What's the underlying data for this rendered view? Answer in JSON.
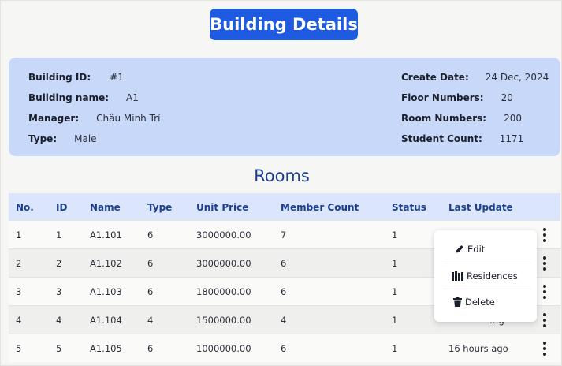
{
  "page": {
    "title": "Building Details"
  },
  "building": {
    "id_label": "Building ID:",
    "id_value": "#1",
    "name_label": "Building name:",
    "name_value": "A1",
    "manager_label": "Manager:",
    "manager_value": "Châu Minh Trí",
    "type_label": "Type:",
    "type_value": "Male",
    "create_label": "Create Date:",
    "create_value": "24 Dec, 2024",
    "floors_label": "Floor Numbers:",
    "floors_value": "20",
    "rooms_label": "Room Numbers:",
    "rooms_value": "200",
    "students_label": "Student Count:",
    "students_value": "1171"
  },
  "rooms": {
    "title": "Rooms",
    "headers": [
      "No.",
      "ID",
      "Name",
      "Type",
      "Unit Price",
      "Member Count",
      "Status",
      "Last Update"
    ],
    "rows": [
      [
        "1",
        "1",
        "A1.101",
        "6",
        "3000000.00",
        "7",
        "1",
        ""
      ],
      [
        "2",
        "2",
        "A1.102",
        "6",
        "3000000.00",
        "6",
        "1",
        ""
      ],
      [
        "3",
        "3",
        "A1.103",
        "6",
        "1800000.00",
        "6",
        "1",
        ""
      ],
      [
        "4",
        "4",
        "A1.104",
        "4",
        "1500000.00",
        "4",
        "1",
        "…g"
      ],
      [
        "5",
        "5",
        "A1.105",
        "6",
        "1000000.00",
        "6",
        "1",
        "16 hours ago"
      ]
    ]
  },
  "action_menu": {
    "edit": "Edit",
    "residences": "Residences",
    "delete": "Delete"
  },
  "icons": {
    "row_actions": "more-vertical-icon",
    "edit": "pen-icon",
    "residences": "books-icon",
    "delete": "trash-icon"
  },
  "colors": {
    "accent": "#1f5be0",
    "info_panel": "#c8d8f8",
    "header_bg": "#dbe5fb",
    "header_text": "#1d3f8f"
  }
}
